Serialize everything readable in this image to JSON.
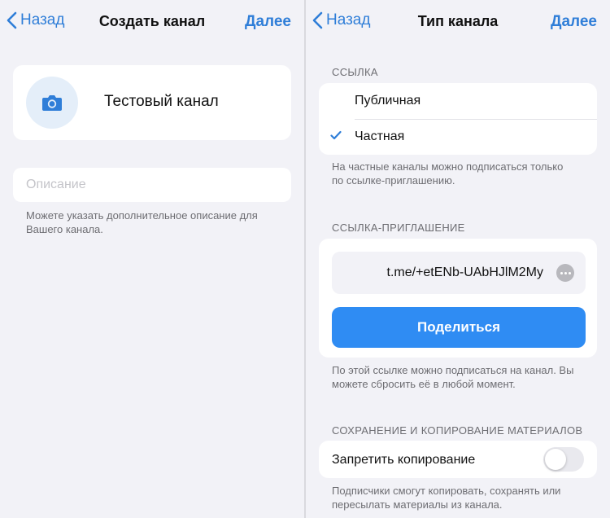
{
  "left": {
    "nav": {
      "back": "Назад",
      "title": "Создать канал",
      "next": "Далее"
    },
    "channel_name": "Тестовый канал",
    "description_placeholder": "Описание",
    "description_hint": "Можете указать дополнительное описание для Вашего канала."
  },
  "right": {
    "nav": {
      "back": "Назад",
      "title": "Тип канала",
      "next": "Далее"
    },
    "link_section": {
      "header": "ССЫЛКА",
      "options": [
        {
          "label": "Публичная",
          "selected": false
        },
        {
          "label": "Частная",
          "selected": true
        }
      ],
      "footer": "На частные каналы можно подписаться только по ссылке-приглашению."
    },
    "invite_section": {
      "header": "ССЫЛКА-ПРИГЛАШЕНИЕ",
      "link": "t.me/+etENb-UAbHJlM2My",
      "share_label": "Поделиться",
      "footer": "По этой ссылке можно подписаться на канал. Вы можете сбросить её в любой момент."
    },
    "content_section": {
      "header": "СОХРАНЕНИЕ И КОПИРОВАНИЕ МАТЕРИАЛОВ",
      "toggle_label": "Запретить копирование",
      "toggle_on": false,
      "footer": "Подписчики смогут копировать, сохранять или пересылать материалы из канала."
    }
  },
  "colors": {
    "accent": "#2f7ed8",
    "button": "#2f8cf3",
    "background": "#f2f2f7"
  },
  "icons": {
    "back": "chevron-left-icon",
    "camera": "camera-icon",
    "check": "checkmark-icon",
    "more": "more-horizontal-icon"
  }
}
